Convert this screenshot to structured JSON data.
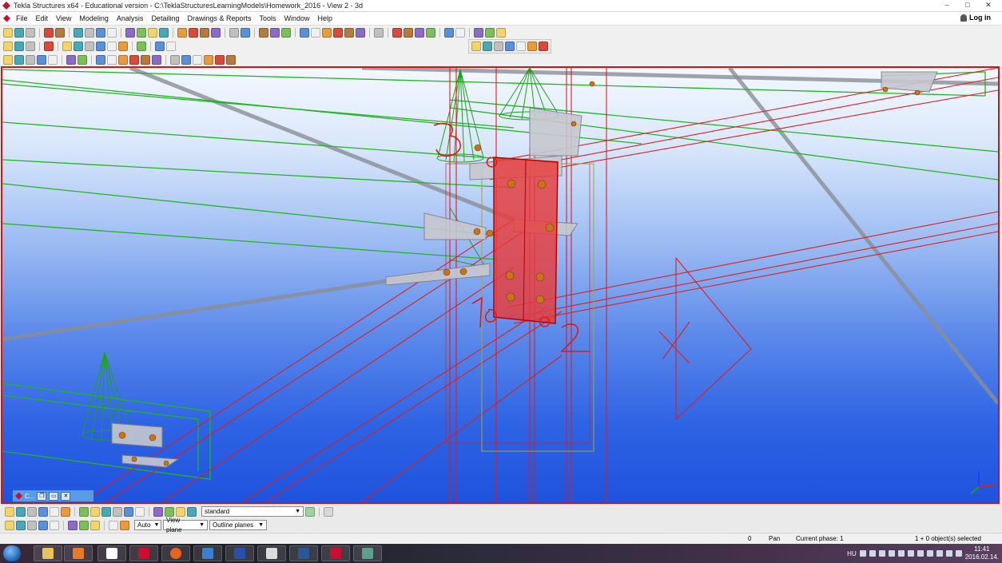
{
  "window": {
    "title": "Tekla Structures x64 - Educational version - C:\\TeklaStructuresLearningModels\\Homework_2016  - View 2 - 3d"
  },
  "menu": {
    "items": [
      "File",
      "Edit",
      "View",
      "Modeling",
      "Analysis",
      "Detailing",
      "Drawings & Reports",
      "Tools",
      "Window",
      "Help"
    ],
    "login": "Log in"
  },
  "viewport": {
    "annotations": [
      "1",
      "2",
      "3"
    ]
  },
  "mini_window": {
    "title": "C...",
    "buttons": [
      "❐",
      "▭",
      "✕"
    ]
  },
  "bottom_toolbar": {
    "filter_select": "standard",
    "snap_mode": "Auto",
    "plane": "View plane",
    "outline": "Outline planes"
  },
  "status": {
    "coord": "0",
    "mode": "Pan",
    "phase": "Current phase: 1",
    "selection": "1 + 0 object(s) selected"
  },
  "taskbar": {
    "language": "HU",
    "time": "11:41",
    "date": "2016.02.14."
  },
  "colors": {
    "selection_red": "#e01010",
    "grid_green": "#22b422",
    "part_red": "#dd1e1e",
    "viewport_blue": "#2e63e4"
  }
}
